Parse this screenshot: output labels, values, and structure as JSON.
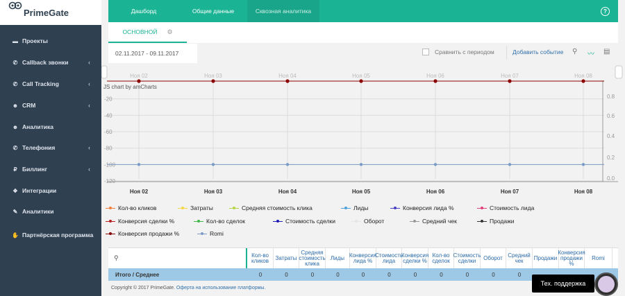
{
  "brand": {
    "name": "PrimeGate"
  },
  "sidebar": {
    "items": [
      {
        "label": "Проекты",
        "icon": "briefcase-icon",
        "glyph": "▬",
        "chevron": false
      },
      {
        "label": "Callback звонки",
        "icon": "phone-volume-icon",
        "glyph": "✆",
        "chevron": true
      },
      {
        "label": "Call Tracking",
        "icon": "phone-volume-icon",
        "glyph": "✆",
        "chevron": true
      },
      {
        "label": "CRM",
        "icon": "users-icon",
        "glyph": "☻",
        "chevron": true
      },
      {
        "label": "Аналитика",
        "icon": "users-icon",
        "glyph": "☻",
        "chevron": false
      },
      {
        "label": "Телефония",
        "icon": "phone-icon",
        "glyph": "✆",
        "chevron": true
      },
      {
        "label": "Биллинг",
        "icon": "ruble-icon",
        "glyph": "₽",
        "chevron": true
      },
      {
        "label": "Интеграции",
        "icon": "cubes-icon",
        "glyph": "❖",
        "chevron": false
      },
      {
        "label": "Аналитики",
        "icon": "wrench-icon",
        "glyph": "✎",
        "chevron": false
      },
      {
        "label": "Партнёрская программа",
        "icon": "handshake-icon",
        "glyph": "✋",
        "chevron": true
      }
    ]
  },
  "topbar": {
    "tabs": [
      "Дашборд",
      "Общие данные",
      "Сквозная аналитика"
    ],
    "help": "?"
  },
  "subtabs": {
    "active": "ОСНОВНОЙ"
  },
  "toolbar": {
    "date_range": "02.11.2017 - 09.11.2017",
    "compare_label": "Сравнить с периодом",
    "add_event": "Добавить событие"
  },
  "chart_data": {
    "type": "line",
    "watermark": "JS chart by amCharts",
    "categories": [
      "Ноя 02",
      "Ноя 03",
      "Ноя 04",
      "Ноя 05",
      "Ноя 06",
      "Ноя 07",
      "Ноя 08"
    ],
    "left_axis_ticks": [
      "-20",
      "-40",
      "-60",
      "-80",
      "-100",
      "-120"
    ],
    "right_axis_ticks": [
      "0.8",
      "0.6",
      "0.4",
      "0.2",
      "0.0"
    ],
    "series": [
      {
        "name": "Конверсия продажи %",
        "color": "#8b0000",
        "values": [
          0,
          0,
          0,
          0,
          0,
          0,
          0
        ]
      },
      {
        "name": "Romi",
        "color": "#7a9cc6",
        "values": [
          -100,
          -100,
          -100,
          -100,
          -100,
          -100,
          -100
        ]
      }
    ],
    "ylim": [
      -120,
      0
    ]
  },
  "legend": {
    "items": [
      {
        "label": "Кол-во кликов",
        "color": "#f07f3a"
      },
      {
        "label": "Затраты",
        "color": "#f5d742"
      },
      {
        "label": "Средняя стоимость клика",
        "color": "#b5d642"
      },
      {
        "label": "Лиды",
        "color": "#4ea0d8"
      },
      {
        "label": "Конверсия лида %",
        "color": "#4a3fc8"
      },
      {
        "label": "Стоимость лида",
        "color": "#e0407a"
      },
      {
        "label": "Конверсия сделки %",
        "color": "#b82020"
      },
      {
        "label": "Кол-во сделок",
        "color": "#3fb84a"
      },
      {
        "label": "Стоимость сделки",
        "color": "#1a1ab8"
      },
      {
        "label": "Оборот",
        "color": "#e6e6e6"
      },
      {
        "label": "Средний чек",
        "color": "#999999"
      },
      {
        "label": "Продажи",
        "color": "#333333"
      },
      {
        "label": "Конверсия продажи %",
        "color": "#8b0000"
      },
      {
        "label": "Romi",
        "color": "#7a9cc6"
      }
    ]
  },
  "table": {
    "headers": [
      "Кол-во кликов",
      "Затраты",
      "Средняя стоимость клика",
      "Лиды",
      "Конверсия лида %",
      "Стоимость лида",
      "Конверсия сделки %",
      "Кол-во сделок",
      "Стоимость сделки",
      "Оборот",
      "Средний чек",
      "Продажи",
      "Конверсия продажи %",
      "Romi"
    ],
    "total_label": "Итого / Среднее",
    "total_values": [
      "0",
      "0",
      "0",
      "0",
      "0",
      "0",
      "0",
      "0",
      "0",
      "0",
      "0",
      "",
      "",
      ""
    ]
  },
  "footer": {
    "copyright": "Copyright © 2017 PrimeGate.",
    "link": "Оферта на использование платформы."
  },
  "support": {
    "label": "Тех. поддержка"
  }
}
